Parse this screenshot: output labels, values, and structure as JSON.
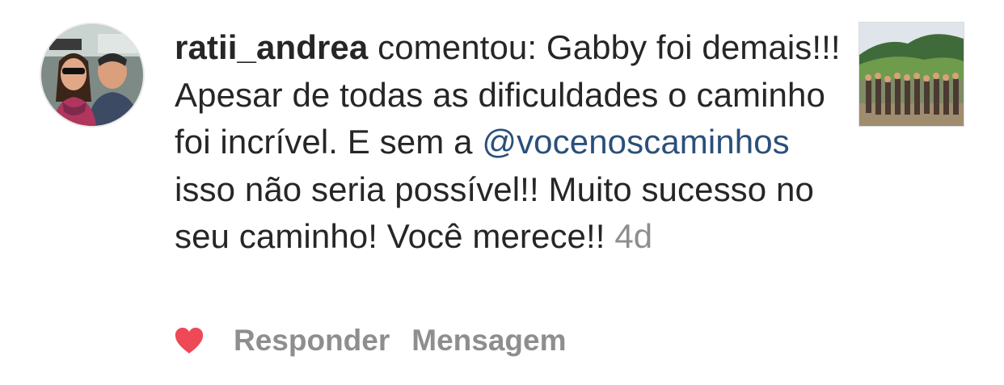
{
  "comment": {
    "username": "ratii_andrea",
    "verb": "comentou:",
    "text_before_mention": "Gabby foi demais!!! Apesar de todas as dificuldades o caminho foi incrível. E sem a",
    "mention": "@vocenoscaminhos",
    "text_after_mention": "isso não seria possível!! Muito sucesso no seu caminho! Você merece!!",
    "time": "4d"
  },
  "actions": {
    "reply_label": "Responder",
    "message_label": "Mensagem"
  },
  "icons": {
    "like": "heart-icon"
  },
  "colors": {
    "text": "#262626",
    "mention": "#2b4f7a",
    "muted": "#8e8e8e",
    "heart": "#ed4956"
  }
}
